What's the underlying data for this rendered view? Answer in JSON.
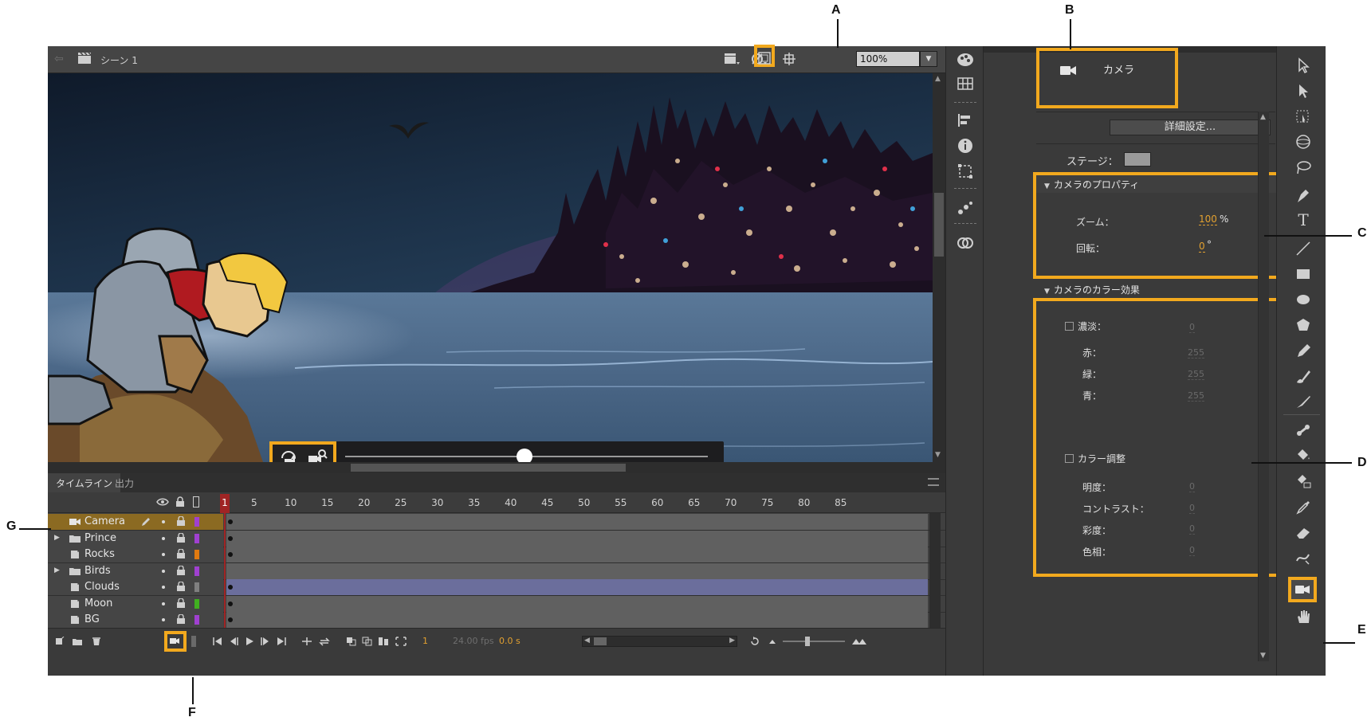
{
  "stage_header": {
    "scene_label": "シーン 1",
    "zoom_value": "100%"
  },
  "timeline": {
    "tabs": [
      "タイムライン",
      "出力"
    ],
    "ruler_ticks": [
      "1",
      "5",
      "10",
      "15",
      "20",
      "25",
      "30",
      "35",
      "40",
      "45",
      "50",
      "55",
      "60",
      "65",
      "70",
      "75",
      "80",
      "85"
    ],
    "layers": [
      {
        "name": "Camera",
        "type": "camera",
        "color": "#a040d0",
        "selected": true,
        "expandable": false,
        "tween": false
      },
      {
        "name": "Prince",
        "type": "folder",
        "color": "#a040d0",
        "selected": false,
        "expandable": true,
        "tween": false
      },
      {
        "name": "Rocks",
        "type": "layer",
        "color": "#e07a10",
        "selected": false,
        "expandable": false,
        "tween": false
      },
      {
        "name": "Birds",
        "type": "folder",
        "color": "#a040d0",
        "selected": false,
        "expandable": true,
        "tween": false
      },
      {
        "name": "Clouds",
        "type": "layer",
        "color": "#808080",
        "selected": false,
        "expandable": false,
        "tween": true
      },
      {
        "name": "Moon",
        "type": "layer",
        "color": "#40b020",
        "selected": false,
        "expandable": false,
        "tween": false
      },
      {
        "name": "BG",
        "type": "layer",
        "color": "#a040d0",
        "selected": false,
        "expandable": false,
        "tween": false
      }
    ],
    "current_frame": "1",
    "fps": "24.00 fps",
    "seconds": "0.0 s"
  },
  "properties": {
    "object_name": "カメラ",
    "advanced_button": "詳細設定...",
    "stage_label": "ステージ：",
    "camera_section": {
      "title": "カメラのプロパティ",
      "zoom_label": "ズーム：",
      "zoom_value": "100",
      "zoom_unit": "%",
      "rotation_label": "回転：",
      "rotation_value": "0",
      "rotation_unit": "°"
    },
    "color_section": {
      "title": "カメラのカラー効果",
      "tint_label": "濃淡：",
      "tint_value": "0",
      "red_label": "赤：",
      "red_value": "255",
      "green_label": "緑：",
      "green_value": "255",
      "blue_label": "青：",
      "blue_value": "255",
      "adjust_label": "カラー調整",
      "brightness_label": "明度：",
      "brightness_value": "0",
      "contrast_label": "コントラスト：",
      "contrast_value": "0",
      "saturation_label": "彩度：",
      "saturation_value": "0",
      "hue_label": "色相：",
      "hue_value": "0"
    }
  },
  "callouts": {
    "a": "A",
    "b": "B",
    "c": "C",
    "d": "D",
    "e": "E",
    "f": "F",
    "g": "G"
  },
  "colors": {
    "highlight": "#f2a91e",
    "accent_value": "#e2a030",
    "playhead": "#a02424"
  }
}
